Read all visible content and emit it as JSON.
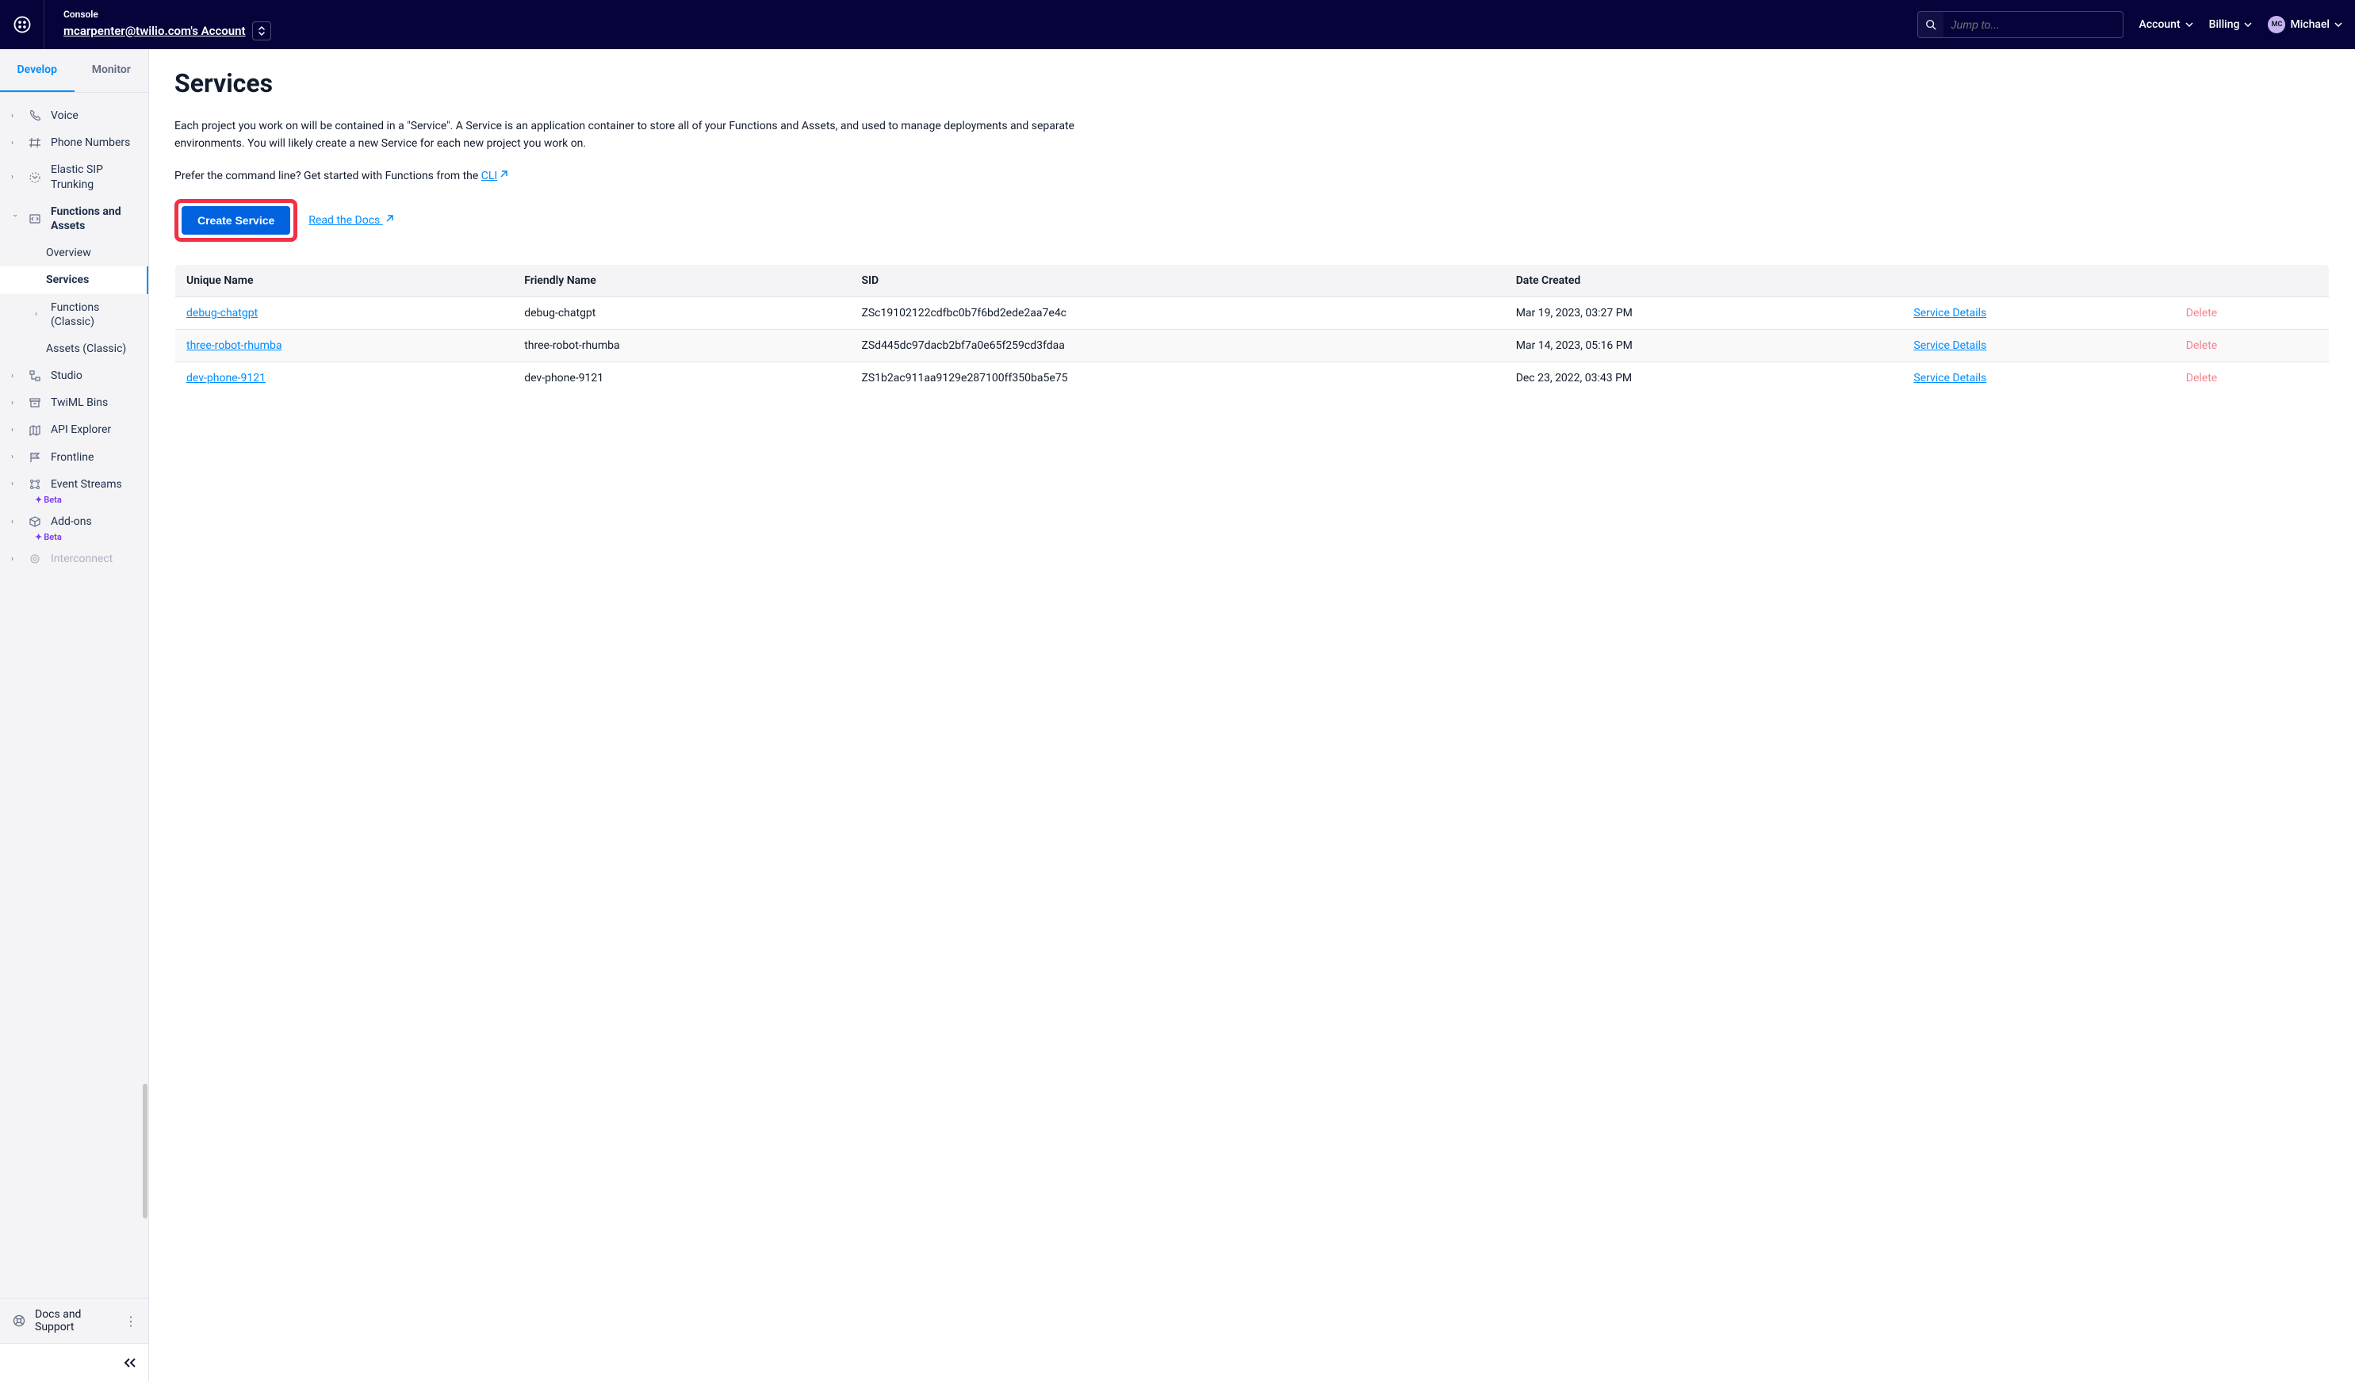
{
  "header": {
    "console_label": "Console",
    "account_link": "mcarpenter@twilio.com's Account",
    "search_placeholder": "Jump to...",
    "menu": {
      "account": "Account",
      "billing": "Billing"
    },
    "user": {
      "initials": "MC",
      "name": "Michael"
    }
  },
  "sidebar": {
    "tabs": {
      "develop": "Develop",
      "monitor": "Monitor"
    },
    "items": {
      "voice": "Voice",
      "phone_numbers": "Phone Numbers",
      "elastic_sip": "Elastic SIP Trunking",
      "functions_assets": "Functions and Assets",
      "overview": "Overview",
      "services": "Services",
      "functions_classic": "Functions (Classic)",
      "assets_classic": "Assets (Classic)",
      "studio": "Studio",
      "twiml_bins": "TwiML Bins",
      "api_explorer": "API Explorer",
      "frontline": "Frontline",
      "event_streams": "Event Streams",
      "addons": "Add-ons",
      "interconnect": "Interconnect",
      "beta": "Beta"
    },
    "footer": "Docs and Support"
  },
  "main": {
    "title": "Services",
    "desc1": "Each project you work on will be contained in a \"Service\". A Service is an application container to store all of your Functions and Assets, and used to manage deployments and separate environments. You will likely create a new Service for each new project you work on.",
    "desc2_prefix": "Prefer the command line? Get started with Functions from the ",
    "desc2_link": "CLI",
    "create_button": "Create Service",
    "read_docs": "Read the Docs",
    "table": {
      "headers": {
        "unique": "Unique Name",
        "friendly": "Friendly Name",
        "sid": "SID",
        "created": "Date Created"
      },
      "details_label": "Service Details",
      "delete_label": "Delete",
      "rows": [
        {
          "unique": "debug-chatgpt",
          "friendly": "debug-chatgpt",
          "sid": "ZSc19102122cdfbc0b7f6bd2ede2aa7e4c",
          "created": "Mar 19, 2023, 03:27 PM"
        },
        {
          "unique": "three-robot-rhumba",
          "friendly": "three-robot-rhumba",
          "sid": "ZSd445dc97dacb2bf7a0e65f259cd3fdaa",
          "created": "Mar 14, 2023, 05:16 PM"
        },
        {
          "unique": "dev-phone-9121",
          "friendly": "dev-phone-9121",
          "sid": "ZS1b2ac911aa9129e287100ff350ba5e75",
          "created": "Dec 23, 2022, 03:43 PM"
        }
      ]
    }
  }
}
